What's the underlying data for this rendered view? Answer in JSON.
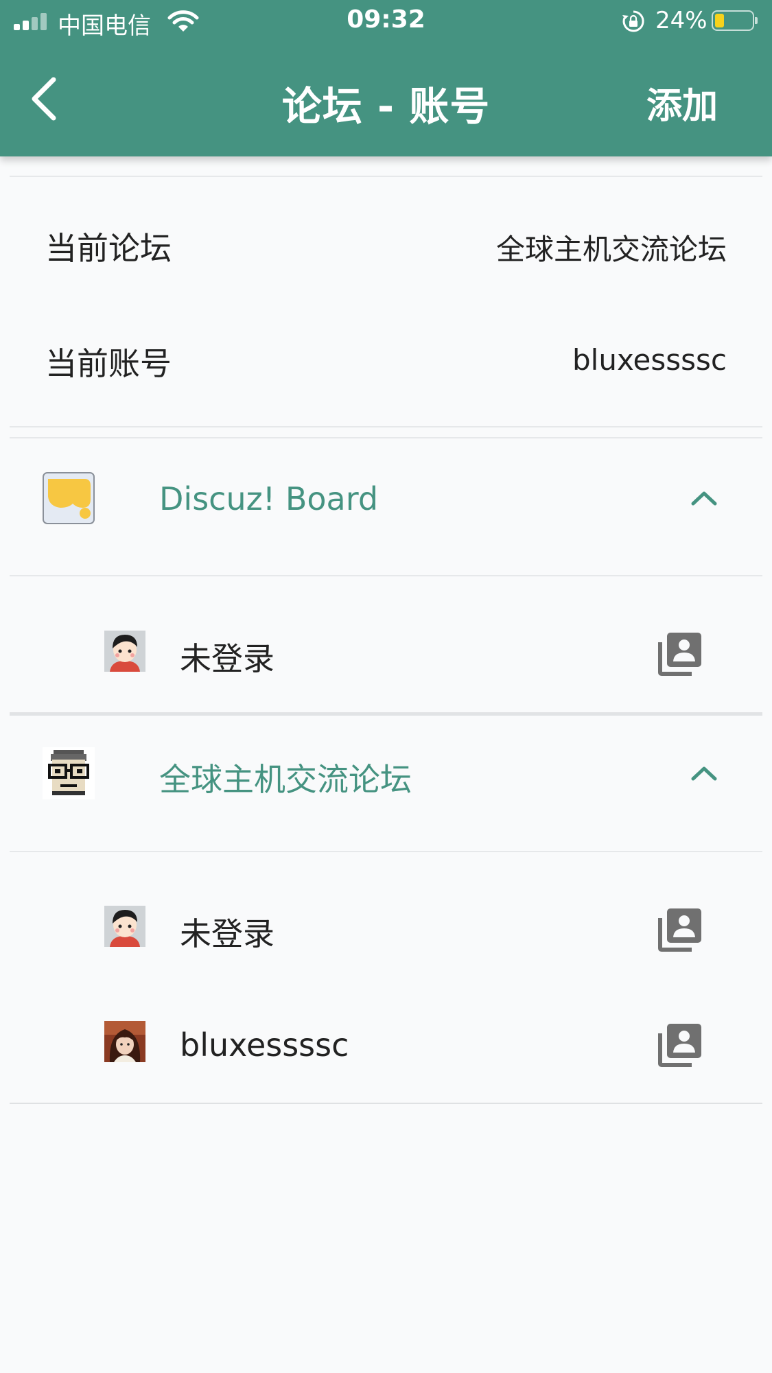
{
  "status_bar": {
    "carrier": "中国电信",
    "time": "09:32",
    "battery_percent": "24%",
    "battery_level": 0.24,
    "icons": [
      "signal-icon",
      "wifi-icon",
      "rotation-lock-icon",
      "battery-icon"
    ]
  },
  "header": {
    "title": "论坛 - 账号",
    "add_label": "添加",
    "back_icon": "chevron-left-icon",
    "bg_color": "#459381"
  },
  "current": {
    "forum_label": "当前论坛",
    "forum_value": "全球主机交流论坛",
    "account_label": "当前账号",
    "account_value": "bluxessssc"
  },
  "forums": [
    {
      "name": "Discuz! Board",
      "icon": "discuz-logo-icon",
      "accounts": [
        {
          "name": "未登录",
          "avatar": "default-avatar-icon",
          "action_icon": "account-switch-icon"
        }
      ]
    },
    {
      "name": "全球主机交流论坛",
      "icon": "pixel-glasses-face-icon",
      "accounts": [
        {
          "name": "未登录",
          "avatar": "default-avatar-icon",
          "action_icon": "account-switch-icon"
        },
        {
          "name": "bluxessssc",
          "avatar": "user-photo-avatar",
          "action_icon": "account-switch-icon"
        }
      ]
    }
  ],
  "colors": {
    "accent": "#459381",
    "background": "#f9fafb",
    "divider": "#e6e8ea"
  }
}
